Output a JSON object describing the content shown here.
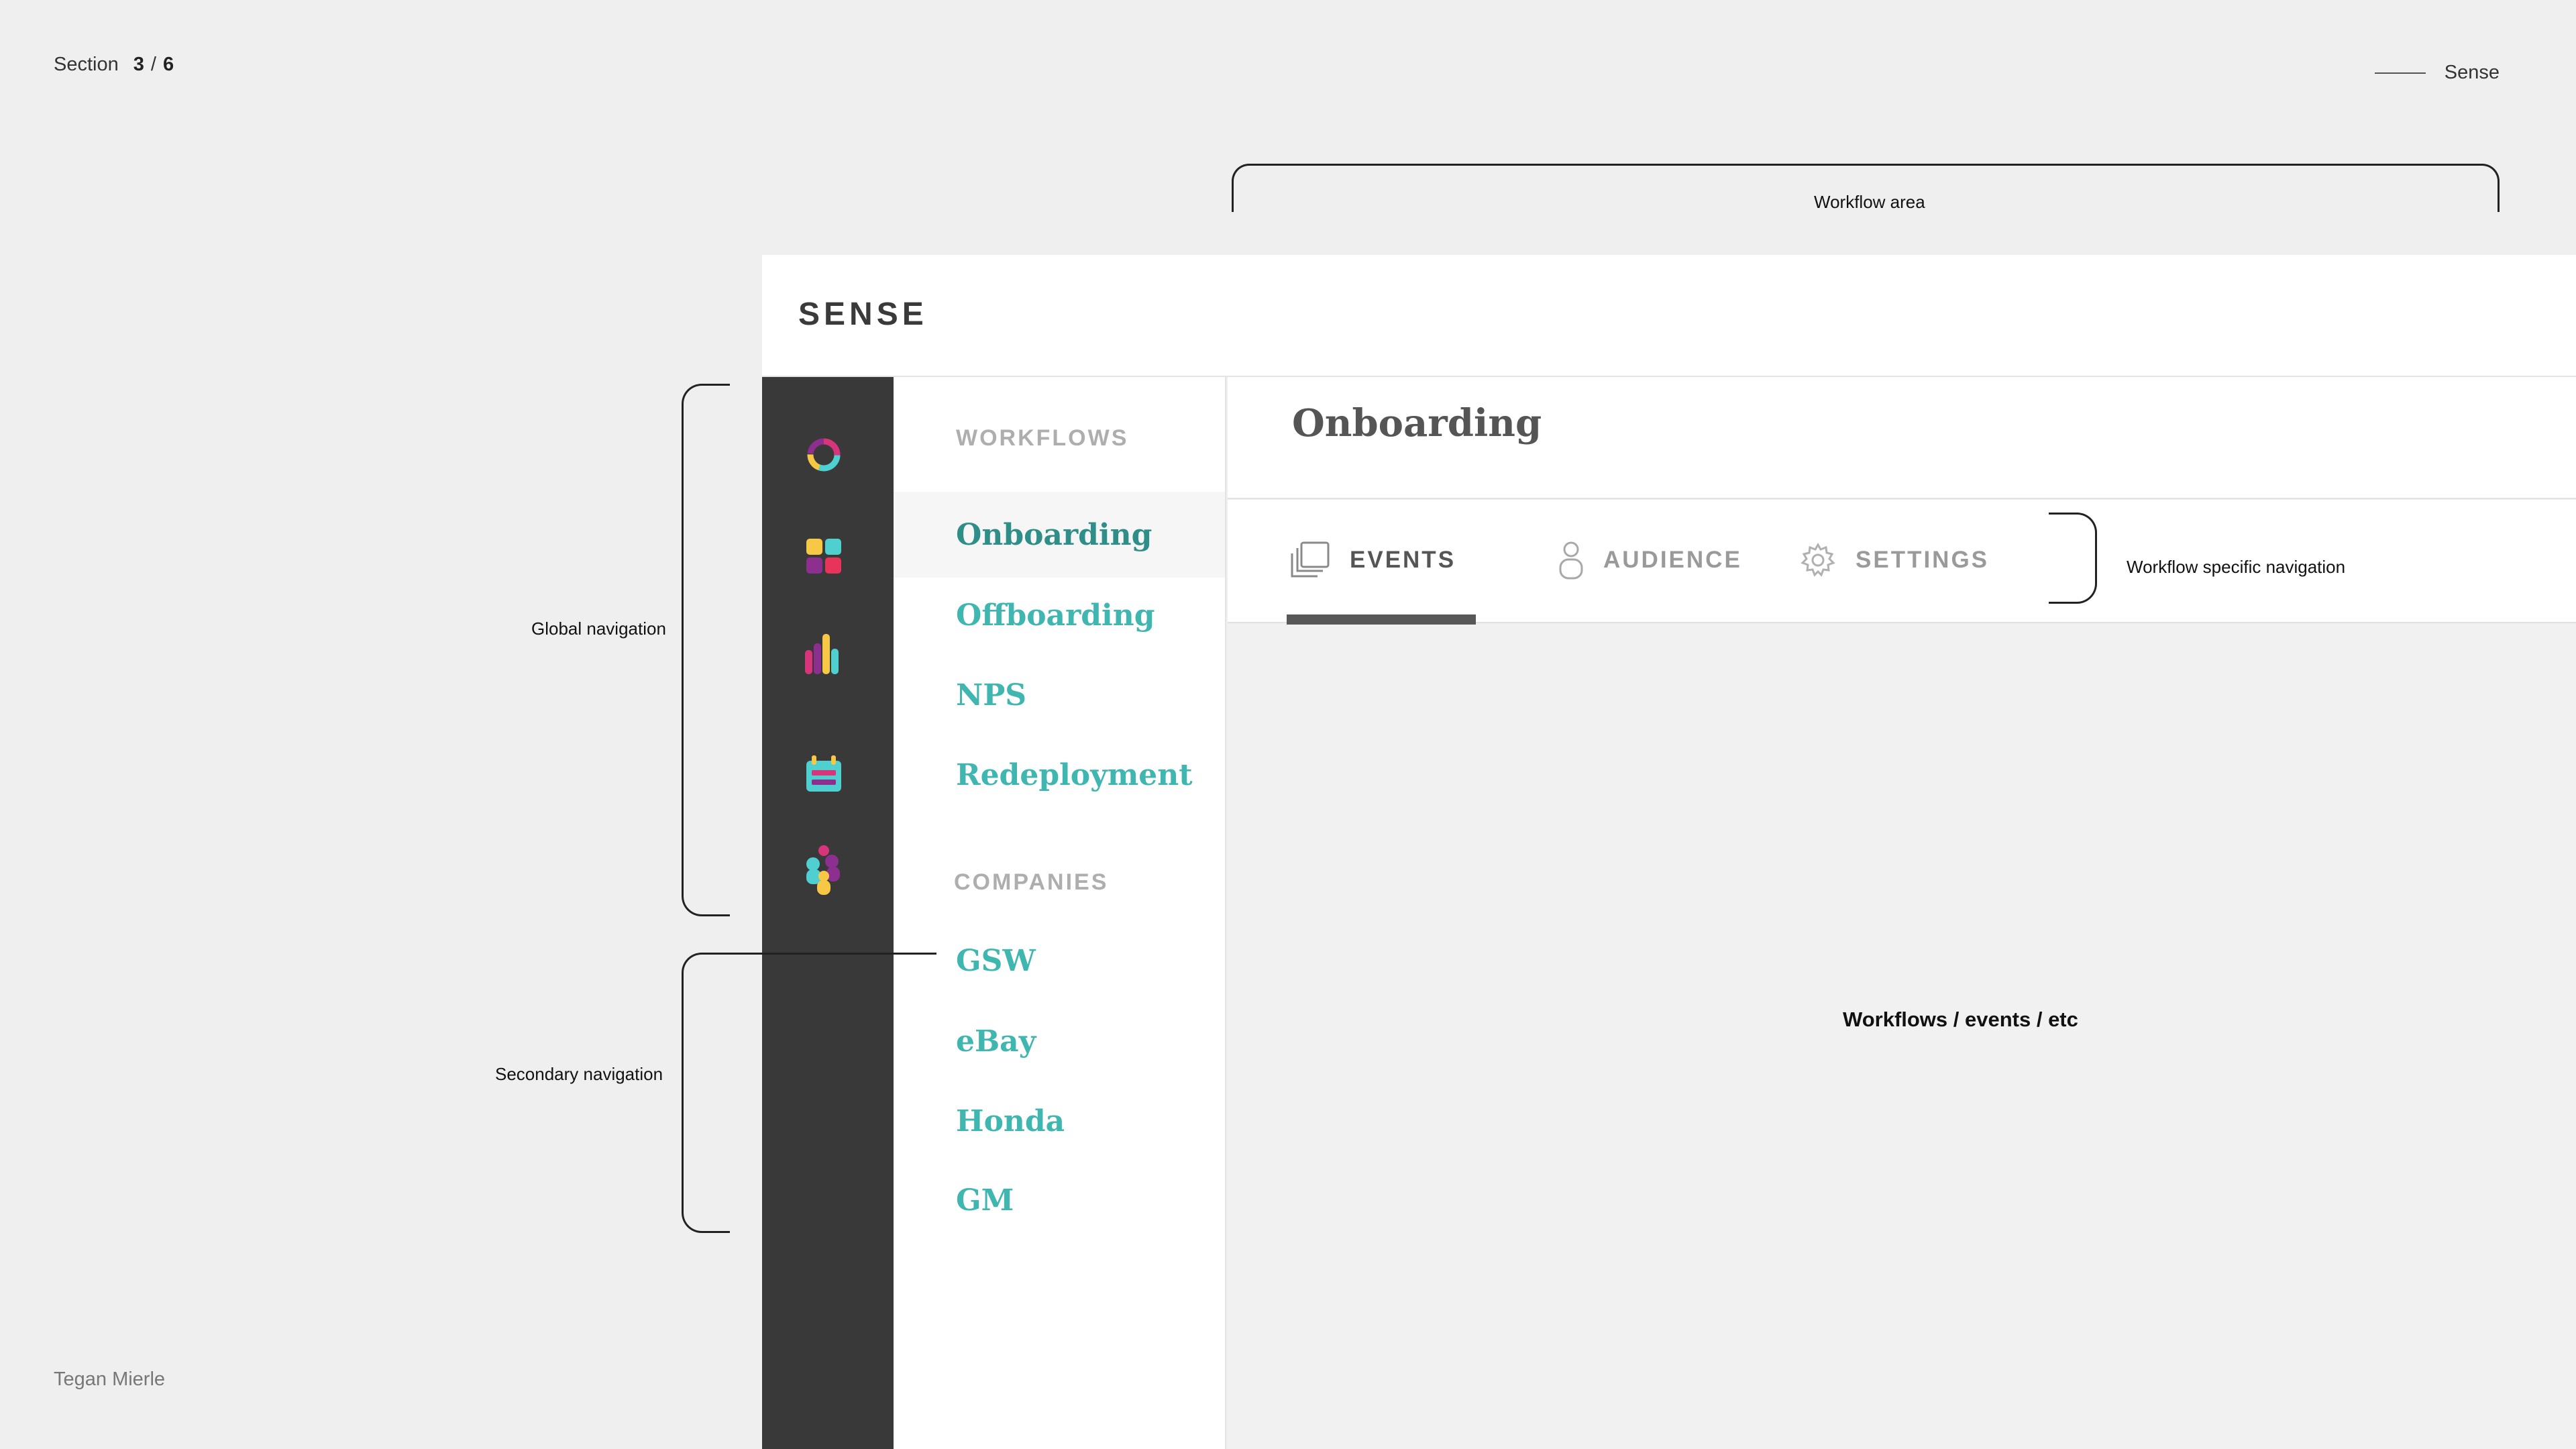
{
  "slide": {
    "section_word": "Section",
    "section_current": "3",
    "section_separator": "/",
    "section_total": "6",
    "brand_tag": "Sense",
    "author": "Tegan Mierle"
  },
  "annotations": {
    "workflow_area": "Workflow area",
    "global_navigation": "Global navigation",
    "secondary_navigation": "Secondary navigation",
    "workflow_specific_navigation": "Workflow specific navigation",
    "content_placeholder": "Workflows / events / etc"
  },
  "app": {
    "logo": "SENSE",
    "global_nav": [
      {
        "icon": "donut-chart-icon"
      },
      {
        "icon": "dashboard-grid-icon"
      },
      {
        "icon": "bar-chart-icon"
      },
      {
        "icon": "calendar-icon"
      },
      {
        "icon": "people-icon"
      }
    ],
    "secondary_nav": {
      "workflows_heading": "WORKFLOWS",
      "workflows": [
        {
          "label": "Onboarding",
          "active": true
        },
        {
          "label": "Offboarding"
        },
        {
          "label": "NPS"
        },
        {
          "label": "Redeployment"
        }
      ],
      "companies_heading": "COMPANIES",
      "companies": [
        {
          "label": "GSW"
        },
        {
          "label": "eBay"
        },
        {
          "label": "Honda"
        },
        {
          "label": "GM"
        }
      ]
    },
    "page_title": "Onboarding",
    "tabs": [
      {
        "label": "EVENTS",
        "icon": "layers-icon",
        "active": true
      },
      {
        "label": "AUDIENCE",
        "icon": "person-icon"
      },
      {
        "label": "SETTINGS",
        "icon": "gear-icon"
      }
    ]
  },
  "colors": {
    "accent_teal": "#3fb6b0",
    "accent_teal_dark": "#2f8f88",
    "rail_bg": "#393939",
    "icon_pink": "#d6357c",
    "icon_purple": "#8c2f8e",
    "icon_yellow": "#f6c845",
    "icon_cyan": "#4fcfd0"
  }
}
